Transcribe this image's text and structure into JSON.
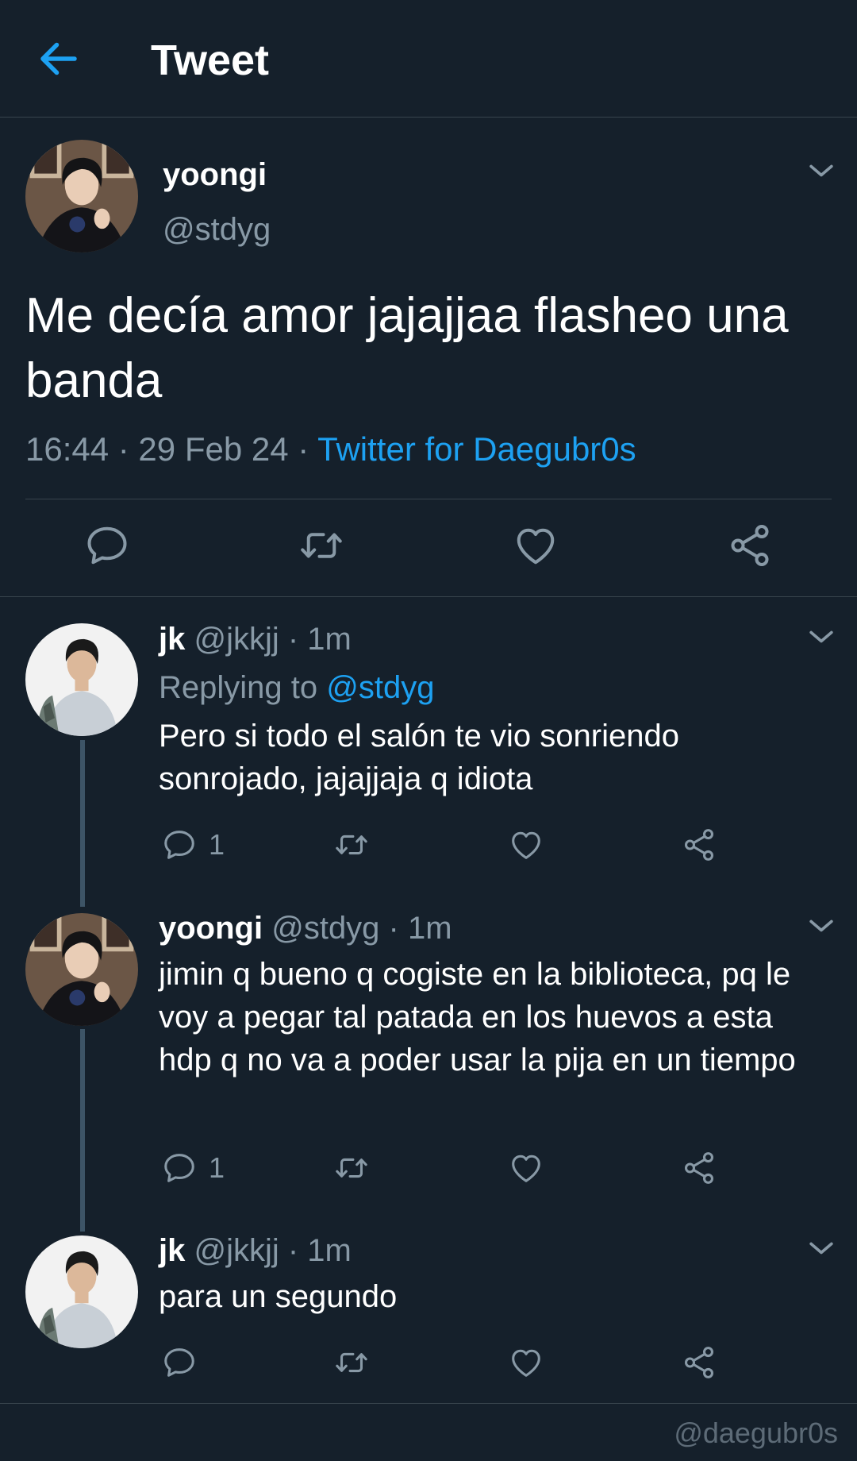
{
  "header": {
    "title": "Tweet"
  },
  "main_tweet": {
    "name": "yoongi",
    "handle": "@stdyg",
    "text": "Me decía amor jajajjaa flasheo una banda",
    "time": "16:44 · 29 Feb 24 · ",
    "source": "Twitter for Daegubr0s"
  },
  "replies": [
    {
      "name": "jk",
      "handle": "@jkkjj · 1m",
      "replying_prefix": "Replying to ",
      "replying_to": "@stdyg",
      "text": "Pero si todo el salón te vio sonriendo sonrojado, jajajjaja q idiota",
      "reply_count": "1"
    },
    {
      "name": "yoongi",
      "handle": "@stdyg · 1m",
      "text": "jimin q bueno q cogiste en la biblioteca, pq le voy a pegar tal patada en los huevos a esta hdp q no va a poder usar la pija en un tiempo",
      "reply_count": "1"
    },
    {
      "name": "jk",
      "handle": "@jkkjj · 1m",
      "text": "para un segundo"
    }
  ],
  "watermark": "@daegubr0s",
  "colors": {
    "background": "#15202b",
    "accent": "#1da1f2",
    "muted_text": "#8899a6",
    "divider": "#38444d",
    "thread_line": "#3d5466"
  },
  "icons": {
    "back": "arrow-left-icon",
    "caret": "chevron-down-icon",
    "reply": "speech-bubble-icon",
    "retweet": "retweet-icon",
    "like": "heart-icon",
    "share": "share-icon"
  }
}
